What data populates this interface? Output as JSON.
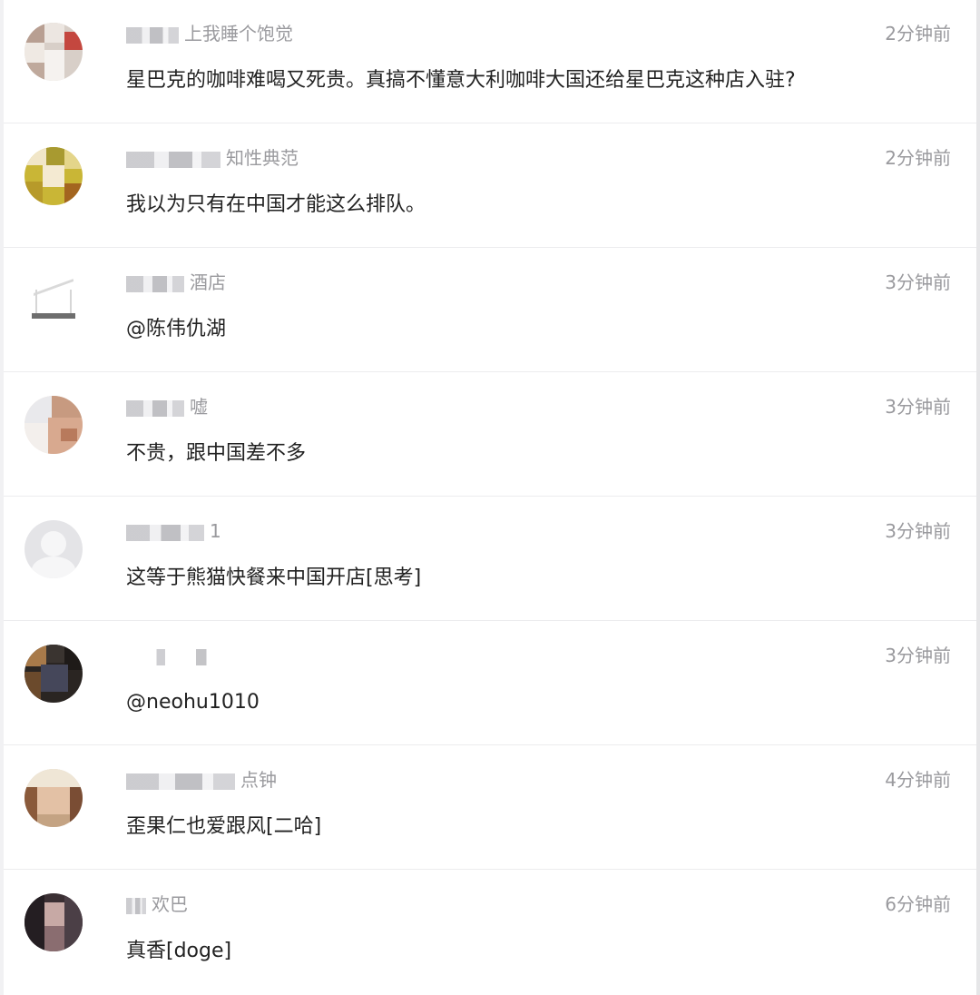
{
  "comments": [
    {
      "name_visible": "上我睡个饱觉",
      "time": "2分钟前",
      "text": "星巴克的咖啡难喝又死贵。真搞不懂意大利咖啡大国还给星巴克这种店入驻?"
    },
    {
      "name_visible": "知性典范",
      "time": "2分钟前",
      "text": "我以为只有在中国才能这么排队。"
    },
    {
      "name_visible": "酒店",
      "time": "3分钟前",
      "text": "@陈伟仇湖"
    },
    {
      "name_visible": "嘘",
      "time": "3分钟前",
      "text": "不贵，跟中国差不多"
    },
    {
      "name_visible": "1",
      "time": "3分钟前",
      "text": "这等于熊猫快餐来中国开店[思考]"
    },
    {
      "name_visible": "",
      "time": "3分钟前",
      "text": "@neohu1010"
    },
    {
      "name_visible": "点钟",
      "time": "4分钟前",
      "text": "歪果仁也爱跟风[二哈]"
    },
    {
      "name_visible": "欢巴",
      "time": "6分钟前",
      "text": "真香[doge]"
    }
  ],
  "colors": {
    "background": "#ffffff",
    "divider": "#ececee",
    "meta_text": "#9a9a9e",
    "body_text": "#222222"
  }
}
